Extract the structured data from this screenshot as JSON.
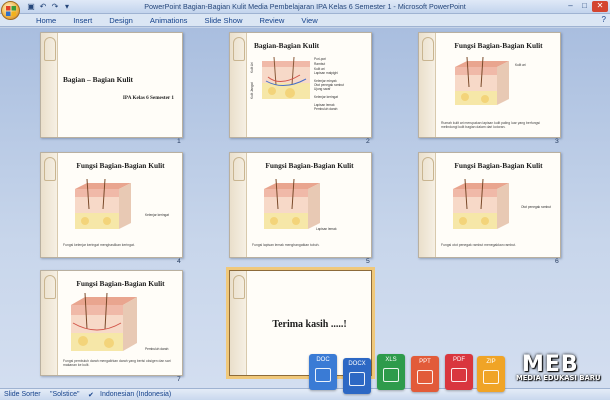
{
  "window": {
    "title": "PowerPoint Bagian-Bagian Kulit Media Pembelajaran IPA Kelas 6 Semester 1 - Microsoft PowerPoint",
    "minimize": "–",
    "maximize": "□",
    "close": "✕"
  },
  "ribbon": {
    "tabs": [
      "Home",
      "Insert",
      "Design",
      "Animations",
      "Slide Show",
      "Review",
      "View"
    ],
    "help": "?"
  },
  "slides": [
    {
      "num": "1",
      "title": "Bagian – Bagian Kulit",
      "subtitle": "IPA Kelas 6 Semester 1",
      "type": "title"
    },
    {
      "num": "2",
      "title": "Bagian-Bagian Kulit",
      "type": "diagram",
      "labels": [
        "Pori-pori",
        "Rambut",
        "Kulit ari",
        "Lapisan malpighi",
        "Kelenjar minyak",
        "Otot penegak rambut",
        "Ujung saraf",
        "Kelenjar keringat",
        "Lapisan lemak",
        "Pembuluh darah"
      ],
      "side_labels": [
        "Kulit Ari",
        "Kulit Jangat"
      ]
    },
    {
      "num": "3",
      "title": "Fungsi Bagian-Bagian Kulit",
      "type": "fungsi",
      "callout": "Kulit ari",
      "caption": "Rumah kulit ari merupakan lapisan kulit paling luar yang berfungsi melindungi kulit bagian dalam dari kotoran."
    },
    {
      "num": "4",
      "title": "Fungsi Bagian-Bagian Kulit",
      "type": "fungsi",
      "callout": "Kelenjar keringat",
      "caption": "Fungsi kelenjar keringat menghasilkan keringat."
    },
    {
      "num": "5",
      "title": "Fungsi Bagian-Bagian Kulit",
      "type": "fungsi",
      "callout": "Lapisan lemak",
      "caption": "Fungsi lapisan lemak menghangatkan tubuh."
    },
    {
      "num": "6",
      "title": "Fungsi Bagian-Bagian Kulit",
      "type": "fungsi",
      "callout": "Otot penegak rambut",
      "caption": "Fungsi otot penegak rambut menegakkan rambut."
    },
    {
      "num": "7",
      "title": "Fungsi Bagian-Bagian Kulit",
      "type": "fungsi",
      "callout": "Pembuluh darah",
      "caption": "Fungsi pembuluh darah mengalirkan darah yang berisi oksigen dan sari makanan ke kulit."
    },
    {
      "num": "8",
      "title": "Terima kasih .....!",
      "type": "end"
    }
  ],
  "status": {
    "view": "Slide Sorter",
    "theme": "\"Solstice\"",
    "language": "Indonesian (Indonesia)"
  },
  "watermark": {
    "files": [
      "DOC",
      "DOCX",
      "XLS",
      "PPT",
      "PDF",
      "ZIP"
    ],
    "brand": "MEB",
    "tagline": "MEDIA EDUKASI BARU"
  },
  "colors": {
    "doc": "#3a7bd5",
    "docx": "#2d68c4",
    "xls": "#2e9b4b",
    "ppt": "#e25b39",
    "pdf": "#d9363e",
    "zip": "#f0a426"
  }
}
